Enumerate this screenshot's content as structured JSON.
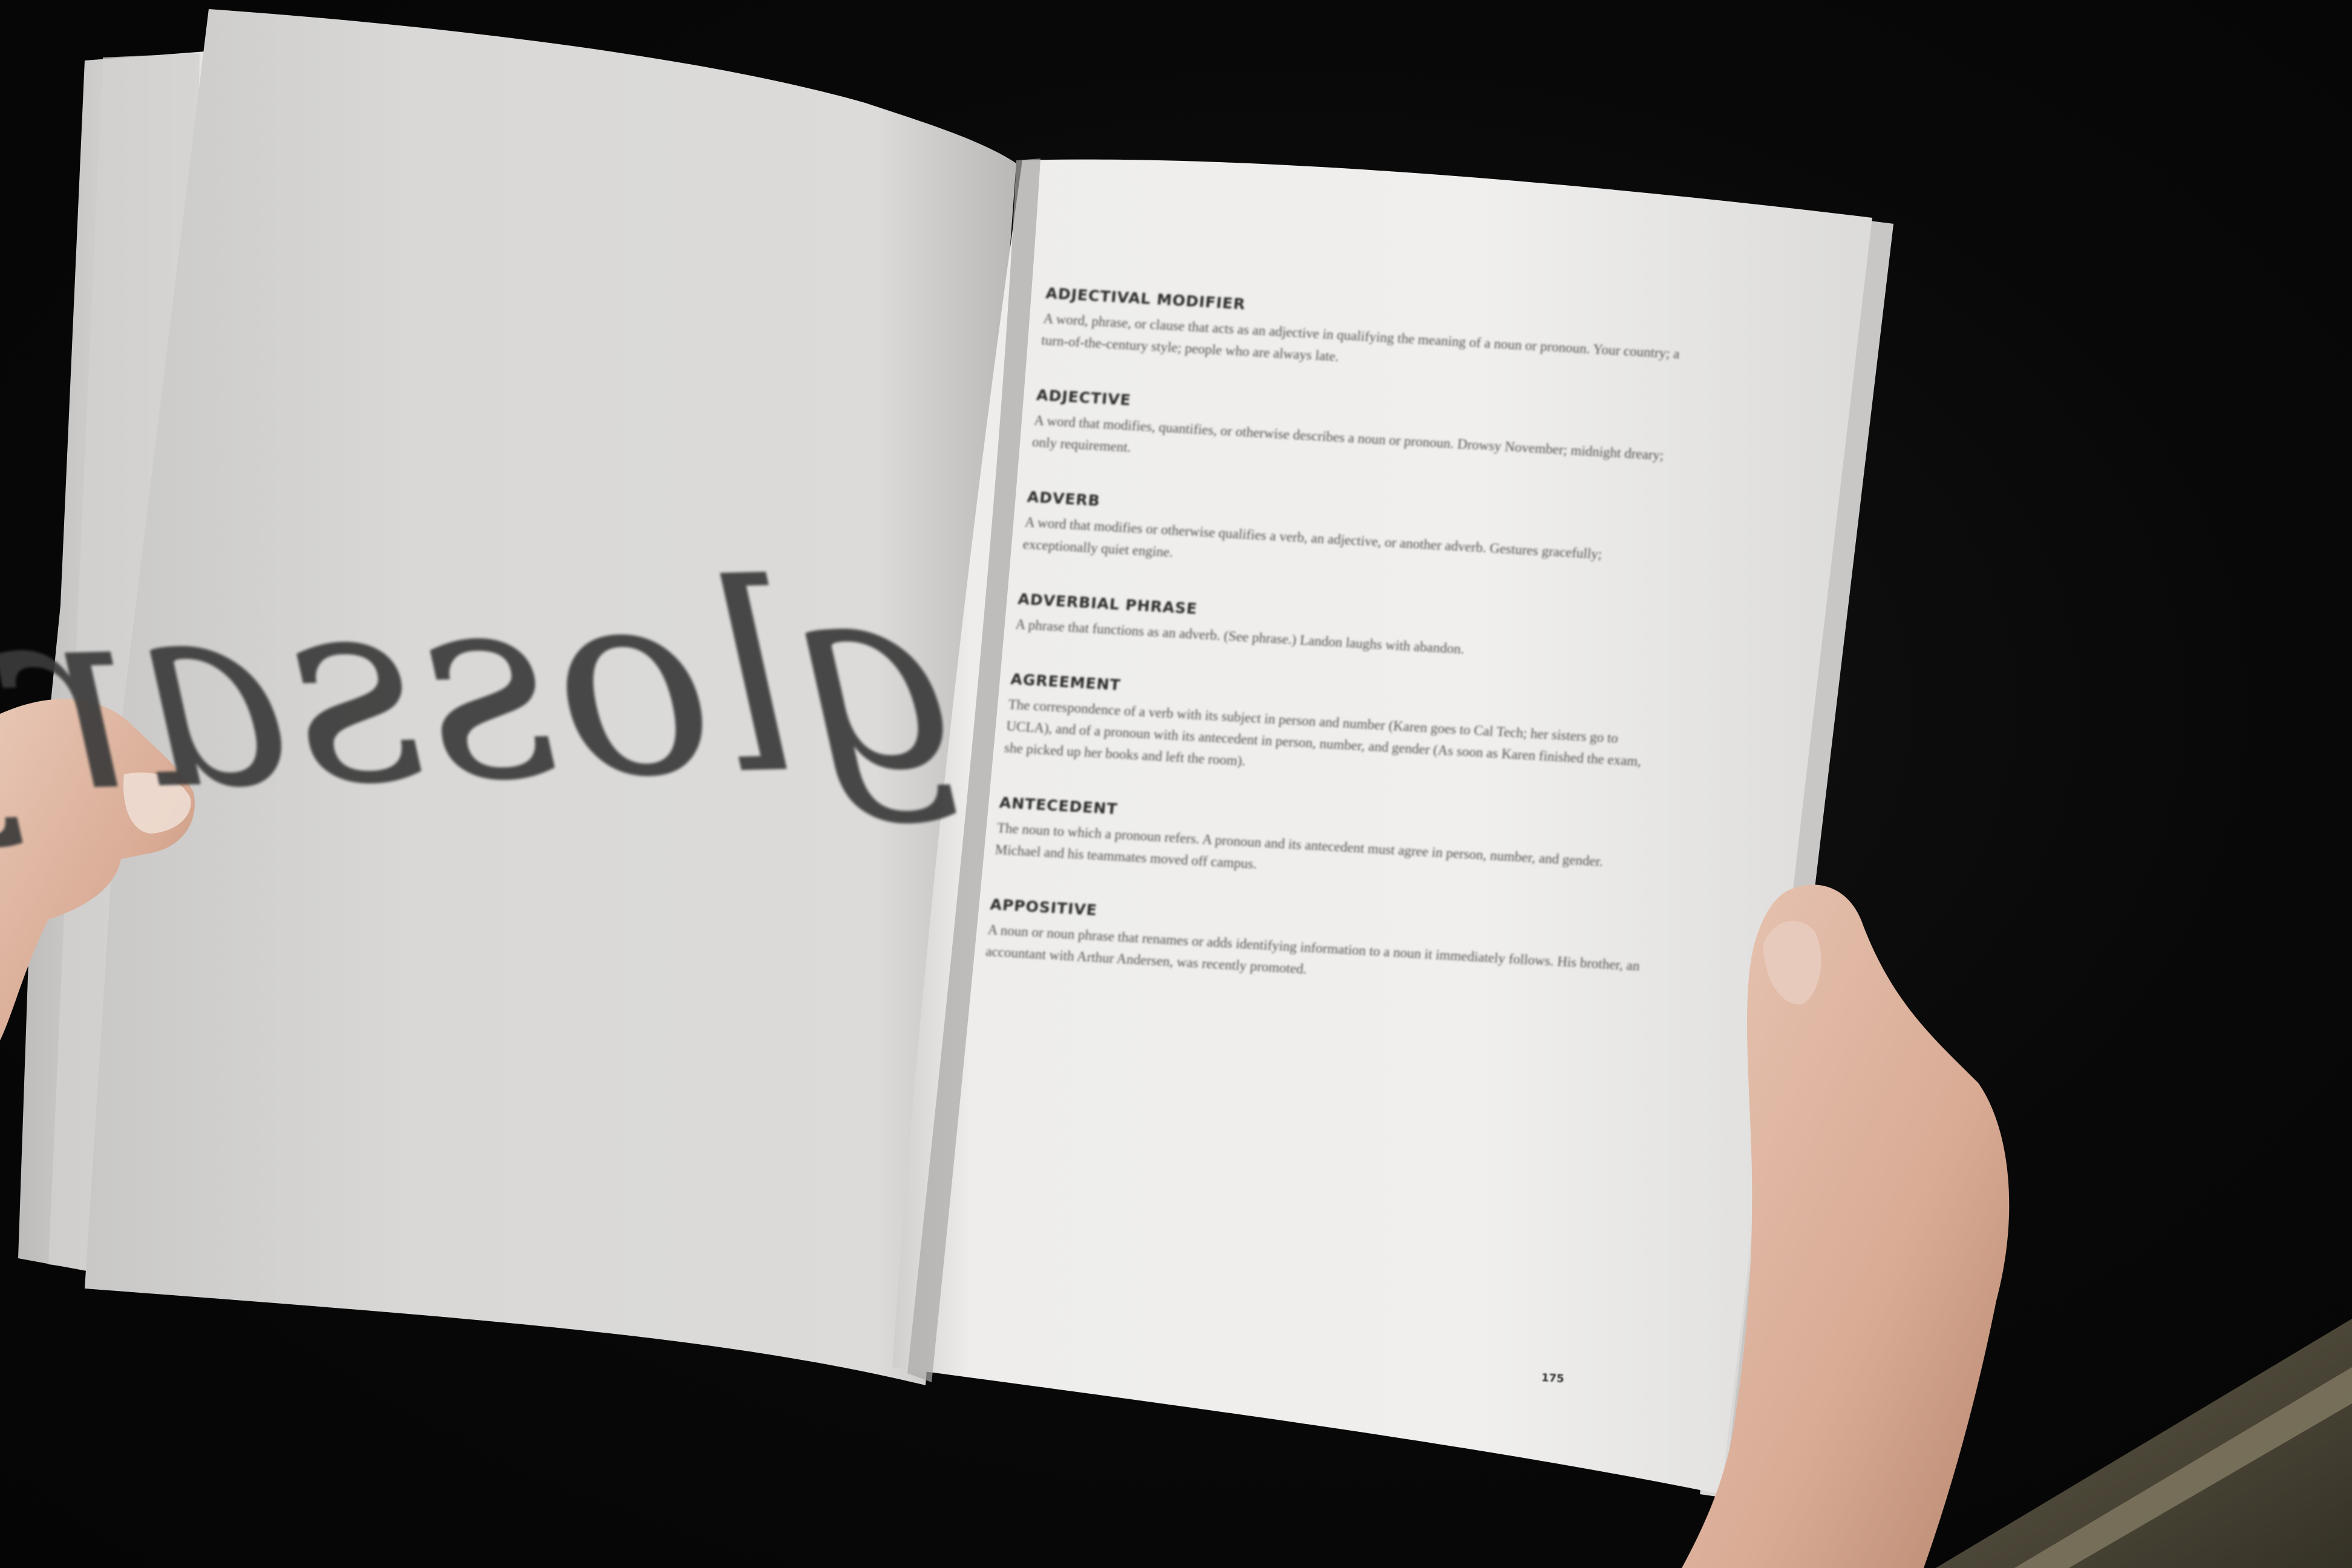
{
  "left_page": {
    "title": "glossary"
  },
  "right_page": {
    "entries": [
      {
        "term": "ADJECTIVAL MODIFIER",
        "definition": "A word, phrase, or clause that acts as an adjective in qualifying the meaning of a noun or pronoun. Your country; a turn-of-the-century style; people who are always late."
      },
      {
        "term": "ADJECTIVE",
        "definition": "A word that modifies, quantifies, or otherwise describes a noun or pronoun. Drowsy November; midnight dreary; only requirement."
      },
      {
        "term": "ADVERB",
        "definition": "A word that modifies or otherwise qualifies a verb, an adjective, or another adverb. Gestures gracefully; exceptionally quiet engine."
      },
      {
        "term": "ADVERBIAL PHRASE",
        "definition": "A phrase that functions as an adverb. (See phrase.) Landon laughs with abandon."
      },
      {
        "term": "AGREEMENT",
        "definition": "The correspondence of a verb with its subject in person and number (Karen goes to Cal Tech; her sisters go to UCLA), and of a pronoun with its antecedent in person, number, and gender (As soon as Karen finished the exam, she picked up her books and left the room)."
      },
      {
        "term": "ANTECEDENT",
        "definition": "The noun to which a pronoun refers. A pronoun and its antecedent must agree in person, number, and gender. Michael and his teammates moved off campus."
      },
      {
        "term": "APPOSITIVE",
        "definition": "A noun or noun phrase that renames or adds identifying information to a noun it immediately follows. His brother, an accountant with Arthur Andersen, was recently promoted."
      }
    ],
    "page_number": "175"
  },
  "colors": {
    "background": "#070707",
    "page": "#e9e8e6",
    "ink": "#3a3a3a"
  }
}
